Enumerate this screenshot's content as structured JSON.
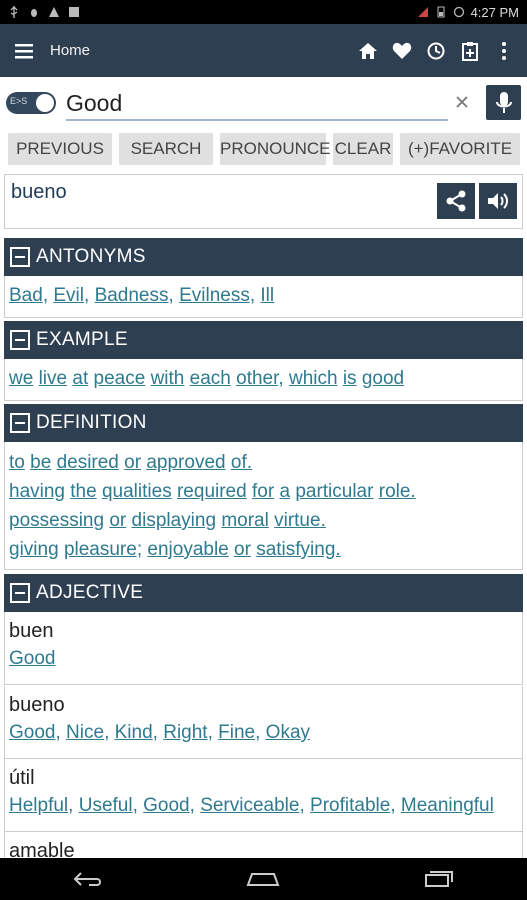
{
  "status_bar": {
    "time": "4:27 PM"
  },
  "app_bar": {
    "title": "Home",
    "icons": [
      "menu-icon",
      "home-icon",
      "heart-icon",
      "history-icon",
      "clipboard-icon",
      "more-vert-icon"
    ]
  },
  "search": {
    "toggle_label": "E>S",
    "value": "Good",
    "placeholder": ""
  },
  "buttons": {
    "previous": "PREVIOUS",
    "search": "SEARCH",
    "pronounce": "PRONOUNCE",
    "clear": "CLEAR",
    "favorite": "(+)FAVORITE"
  },
  "result": {
    "word": "bueno"
  },
  "antonyms": {
    "title": "ANTONYMS",
    "items": [
      "Bad",
      "Evil",
      "Badness",
      "Evilness",
      "Ill"
    ]
  },
  "example": {
    "title": "EXAMPLE",
    "words": [
      "we",
      "live",
      "at",
      "peace",
      "with",
      "each",
      "other,",
      "which",
      "is",
      "good"
    ]
  },
  "definition": {
    "title": "DEFINITION",
    "lines": [
      [
        "to",
        "be",
        "desired",
        "or",
        "approved",
        "of."
      ],
      [
        "having",
        "the",
        "qualities",
        "required",
        "for",
        "a",
        "particular",
        "role."
      ],
      [
        "possessing",
        "or",
        "displaying",
        "moral",
        "virtue."
      ],
      [
        "giving",
        "pleasure;",
        "enjoyable",
        "or",
        "satisfying."
      ]
    ]
  },
  "adjective": {
    "title": "ADJECTIVE",
    "items": [
      {
        "word": "buen",
        "translations": [
          "Good"
        ]
      },
      {
        "word": "bueno",
        "translations": [
          "Good",
          "Nice",
          "Kind",
          "Right",
          "Fine",
          "Okay"
        ]
      },
      {
        "word": "útil",
        "translations": [
          "Helpful",
          "Useful",
          "Good",
          "Serviceable",
          "Profitable",
          "Meaningful"
        ]
      },
      {
        "word": "amable",
        "translations": []
      }
    ]
  },
  "colors": {
    "primary": "#2f3f52",
    "link": "#2f7a8f",
    "button_bg": "#e0e0e0"
  }
}
